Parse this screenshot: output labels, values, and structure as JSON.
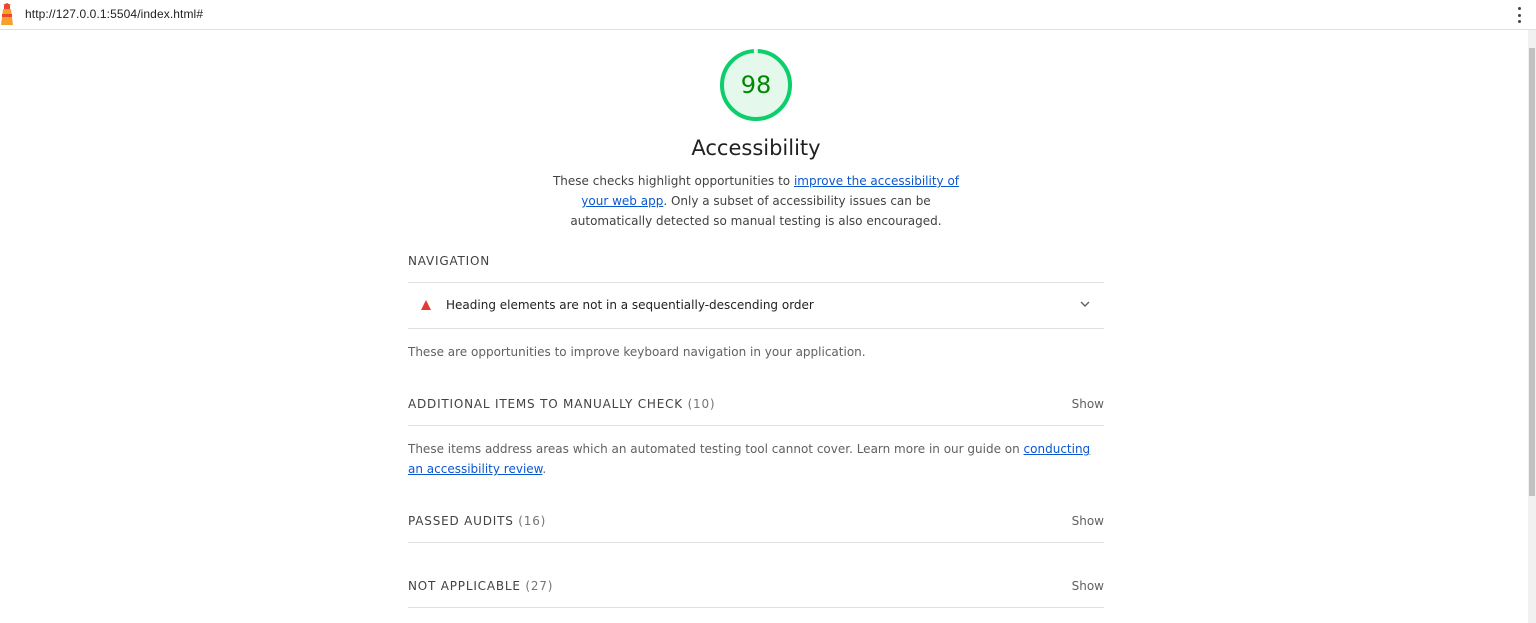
{
  "browser": {
    "url": "http://127.0.0.1:5504/index.html#"
  },
  "category": {
    "score": "98",
    "score_fraction": 0.98,
    "title": "Accessibility",
    "description_prefix": "These checks highlight opportunities to ",
    "description_link": "improve the accessibility of your web app",
    "description_suffix": ". Only a subset of accessibility issues can be automatically detected so manual testing is also encouraged.",
    "gauge_color": "#0cce6b",
    "gauge_bg": "#e5f8ec",
    "score_color": "#008800"
  },
  "navigation": {
    "heading": "NAVIGATION",
    "audit": {
      "title": "Heading elements are not in a sequentially-descending order",
      "status_color": "#e53935"
    },
    "description": "These are opportunities to improve keyboard navigation in your application."
  },
  "manual": {
    "heading": "ADDITIONAL ITEMS TO MANUALLY CHECK",
    "count": "(10)",
    "show_label": "Show",
    "description_prefix": "These items address areas which an automated testing tool cannot cover. Learn more in our guide on ",
    "description_link": "conducting an accessibility review",
    "description_suffix": "."
  },
  "passed": {
    "heading": "PASSED AUDITS",
    "count": "(16)",
    "show_label": "Show"
  },
  "not_applicable": {
    "heading": "NOT APPLICABLE",
    "count": "(27)",
    "show_label": "Show"
  }
}
